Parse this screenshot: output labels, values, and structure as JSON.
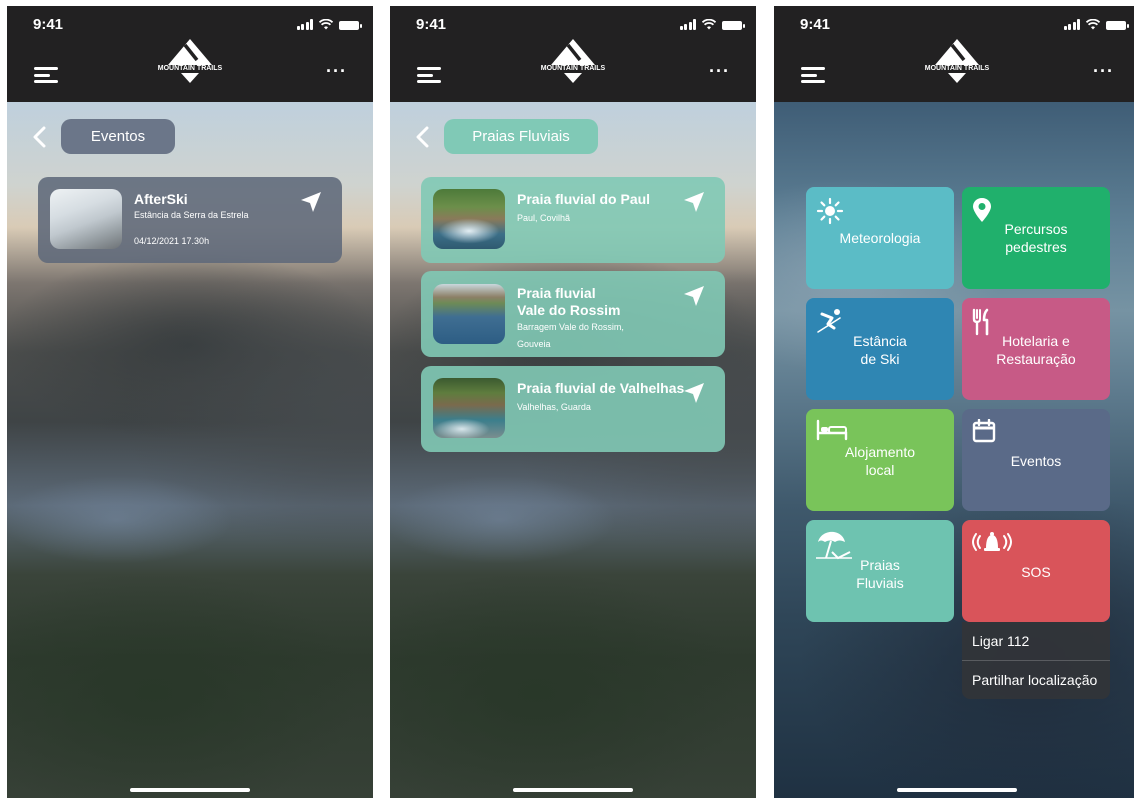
{
  "status": {
    "time": "9:41"
  },
  "brand": {
    "name": "MOUNTAIN TRAILS"
  },
  "screen1": {
    "back_pill": "Eventos",
    "events": [
      {
        "title": "AfterSki",
        "location": "Estância da Serra da Estrela",
        "date": "04/12/2021 17.30h"
      }
    ]
  },
  "screen2": {
    "back_pill": "Praias Fluviais",
    "beaches": [
      {
        "title": "Praia fluvial do Paul",
        "location": "Paul, Covilhã"
      },
      {
        "title_line1": "Praia fluvial",
        "title_line2": "Vale do Rossim",
        "location_line1": "Barragem Vale do Rossim,",
        "location_line2": "Gouveia"
      },
      {
        "title": "Praia fluvial de Valhelhas",
        "location": "Valhelhas, Guarda"
      }
    ]
  },
  "screen3": {
    "tiles": [
      {
        "line1": "Meteorologia",
        "line2": "",
        "color": "#5bbcc6",
        "icon": "sun-icon"
      },
      {
        "line1": "Percursos",
        "line2": "pedestres",
        "color": "#20b06c",
        "icon": "map-pin-icon"
      },
      {
        "line1": "Estância",
        "line2": "de Ski",
        "color": "#2f86b3",
        "icon": "skier-icon"
      },
      {
        "line1": "Hotelaria e",
        "line2": "Restauração",
        "color": "#c75a86",
        "icon": "fork-knife-icon"
      },
      {
        "line1": "Alojamento",
        "line2": "local",
        "color": "#79c45a",
        "icon": "bed-icon"
      },
      {
        "line1": "Eventos",
        "line2": "",
        "color": "#5a6a88",
        "icon": "calendar-icon"
      },
      {
        "line1": "Praias",
        "line2": "Fluviais",
        "color": "#6ec3b0",
        "icon": "beach-umbrella-icon"
      },
      {
        "line1": "SOS",
        "line2": "",
        "color": "#d9545a",
        "icon": "alarm-bell-icon"
      }
    ],
    "sos_menu": [
      "Ligar 112",
      "Partilhar localização"
    ]
  }
}
